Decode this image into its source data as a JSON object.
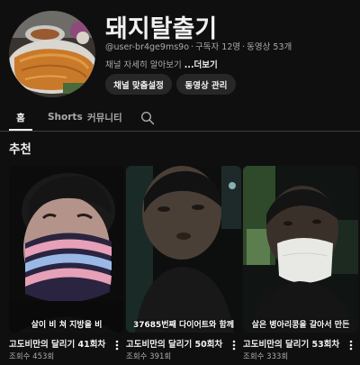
{
  "channel": {
    "name": "돼지탈출기",
    "handle": "@user-br4ge9ms9o",
    "subscribers": "구독자 12명",
    "videos": "동영상 53개",
    "description": "채널 자세히 알아보기 ",
    "more_link": "...더보기"
  },
  "actions": {
    "customize_label": "채널 맞춤설정",
    "manage_label": "동영상 관리"
  },
  "tabs": [
    {
      "label": "홈",
      "active": true
    },
    {
      "label": "Shorts",
      "active": false
    },
    {
      "label": "커뮤니티",
      "active": false
    }
  ],
  "section": {
    "title": "추천"
  },
  "videos": [
    {
      "title": "고도비만의 달리기 41회차",
      "views": "조회수 453회",
      "caption": "살이 비 쳐 지방을 비"
    },
    {
      "title": "고도비만의 달리기 50회차",
      "views": "조회수 391회",
      "caption": "37685번째 다이어트와 함께"
    },
    {
      "title": "고도비만의 달리기 53회차",
      "views": "조회수 333회",
      "caption": "살은 병아리콩을 갈아서 만든"
    }
  ],
  "icons": {
    "search": "search-icon",
    "more": "more-vert-icon"
  },
  "colors": {
    "background": "#0f0f0f",
    "button": "#272727",
    "text_primary": "#f1f1f1",
    "text_secondary": "#aaaaaa"
  }
}
